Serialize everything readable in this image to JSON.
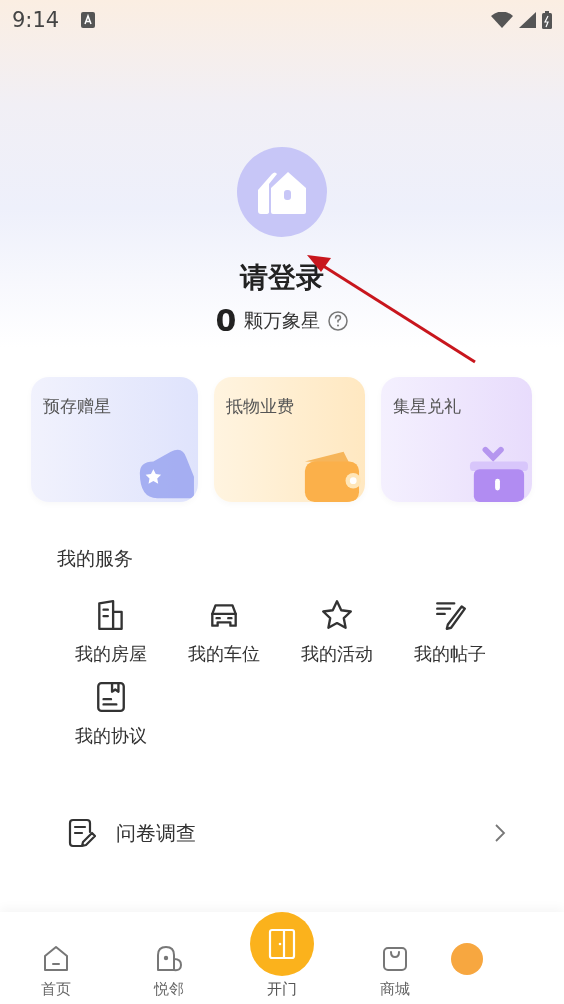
{
  "status_bar": {
    "time": "9:14"
  },
  "profile": {
    "title": "请登录",
    "stars_count": "0",
    "stars_label": "颗万象星"
  },
  "cards": [
    {
      "kind": "wallet-star",
      "label": "预存赠星"
    },
    {
      "kind": "wallet",
      "label": "抵物业费"
    },
    {
      "kind": "gift",
      "label": "集星兑礼"
    }
  ],
  "services": {
    "title": "我的服务",
    "items": [
      {
        "kind": "house",
        "label": "我的房屋"
      },
      {
        "kind": "car",
        "label": "我的车位"
      },
      {
        "kind": "star",
        "label": "我的活动"
      },
      {
        "kind": "post",
        "label": "我的帖子"
      },
      {
        "kind": "agreement",
        "label": "我的协议"
      }
    ]
  },
  "survey": {
    "label": "问卷调查"
  },
  "tab_bar": {
    "tabs": [
      {
        "label": "首页",
        "selected": false
      },
      {
        "label": "悦邻",
        "selected": false
      },
      {
        "label": "开门",
        "kind": "center",
        "selected": false
      },
      {
        "label": "商城",
        "selected": false
      },
      {
        "selected": true
      }
    ]
  }
}
